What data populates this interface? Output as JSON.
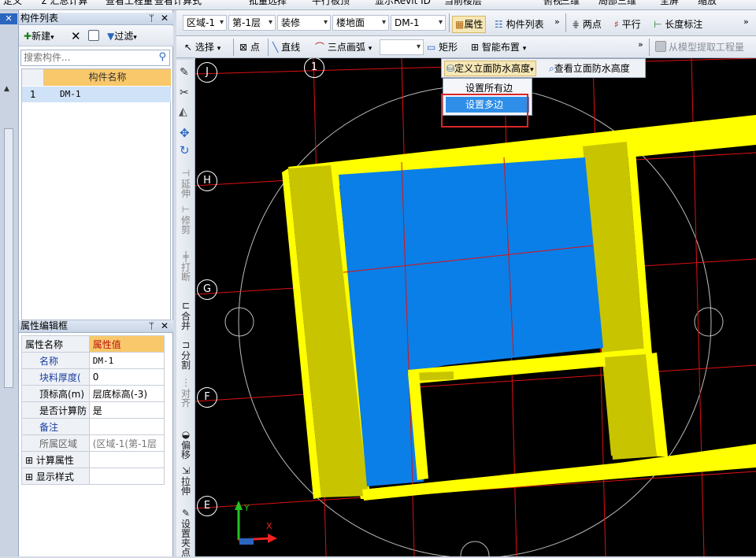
{
  "top_toolbar": {
    "items": [
      "定义",
      "Σ 汇总计算",
      "查看工程量",
      "查看计算式",
      "批量选择",
      "平行板顶",
      "显示Revit ID",
      "当前楼层",
      "俯视",
      "三维",
      "局部三维",
      "全屏",
      "缩放"
    ]
  },
  "component_list": {
    "title": "构件列表",
    "new_label": "新建",
    "filter_label": "过滤",
    "search_placeholder": "搜索构件...",
    "column_header": "构件名称",
    "rows": [
      {
        "num": "1",
        "name": "DM-1"
      }
    ]
  },
  "property_panel": {
    "title": "属性编辑框",
    "col_name": "属性名称",
    "col_value": "属性值",
    "rows": [
      {
        "name": "名称",
        "value": "DM-1"
      },
      {
        "name": "块料厚度(",
        "value": "0"
      },
      {
        "name": "顶标高(m)",
        "value": "层底标高(-3)"
      },
      {
        "name": "是否计算防",
        "value": "是"
      },
      {
        "name": "备注",
        "value": ""
      },
      {
        "name": "所属区域",
        "value": "(区域-1(第-1层"
      },
      {
        "name": "计算属性",
        "value": ""
      },
      {
        "name": "显示样式",
        "value": ""
      }
    ]
  },
  "toolbar2": {
    "region": "区域-1",
    "floor": "第-1层",
    "category": "装修",
    "subcategory": "楼地面",
    "component": "DM-1",
    "properties": "属性",
    "component_list": "构件列表",
    "two_points": "两点",
    "parallel": "平行",
    "length_dim": "长度标注"
  },
  "toolbar3": {
    "select": "选择",
    "point": "点",
    "line": "直线",
    "arc3": "三点画弧",
    "rect": "矩形",
    "smart": "智能布置",
    "extract": "从模型提取工程量"
  },
  "waterproof": {
    "define_btn": "定义立面防水高度",
    "view_btn": "查看立面防水高度",
    "menu_items": [
      "设置所有边",
      "设置多边"
    ]
  },
  "vertical_tools": [
    "延伸",
    "修剪",
    "打断",
    "合并",
    "分割",
    "对齐",
    "偏移",
    "拉伸",
    "设置夹点"
  ],
  "grid_labels": {
    "rows": [
      "J",
      "H",
      "G",
      "F",
      "E"
    ],
    "cols": [
      "1"
    ]
  },
  "axes": {
    "y": "Y",
    "x": "X"
  },
  "colors": {
    "slab": "#0a7fe8",
    "wall": "#ffff00",
    "wall_shade": "#c8c400",
    "grid": "#d11",
    "bg": "#000000",
    "highlight": "#d9262a"
  }
}
